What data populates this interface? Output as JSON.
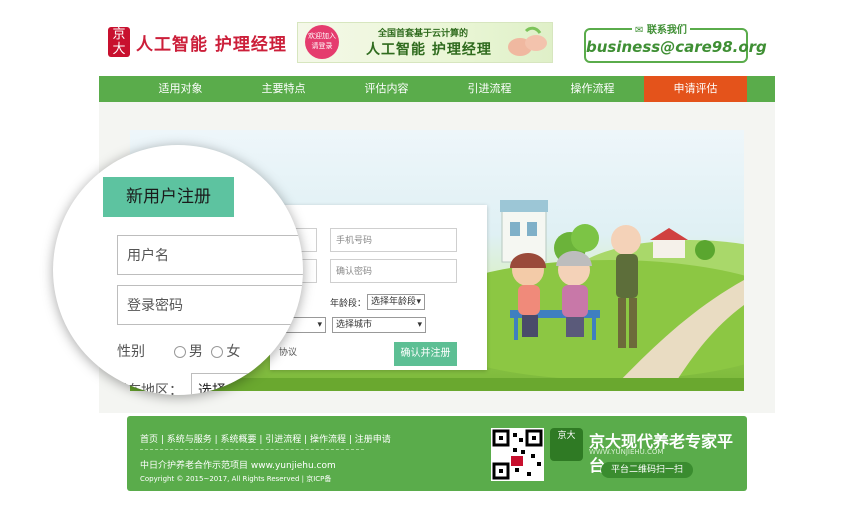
{
  "header": {
    "logo_glyph": "京大",
    "logo_text": "人工智能 护理经理",
    "banner": {
      "badge": "欢迎加入 请登录",
      "line1": "全国首套基于云计算的",
      "line2": "人工智能  护理经理"
    },
    "contact_label": "联系我们",
    "contact_email": "business@care98.org"
  },
  "nav": [
    {
      "label": "适用对象",
      "active": false
    },
    {
      "label": "主要特点",
      "active": false
    },
    {
      "label": "评估内容",
      "active": false
    },
    {
      "label": "引进流程",
      "active": false
    },
    {
      "label": "操作流程",
      "active": false
    },
    {
      "label": "申请评估",
      "active": true
    }
  ],
  "form": {
    "phone_placeholder": "手机号码",
    "confirm_password_placeholder": "确认密码",
    "age_label": "年龄段：",
    "age_select": "选择年龄段",
    "province_select": "",
    "city_select": "选择城市",
    "agreement_text": "协议",
    "submit_label": "确认并注册"
  },
  "magnifier": {
    "title": "新用户注册",
    "username_placeholder": "用户名",
    "password_placeholder": "登录密码",
    "gender_label": "性别",
    "gender_male": "男",
    "gender_female": "女",
    "region_label": "所在地区：",
    "region_select": "选择省"
  },
  "footer": {
    "links": "首页 | 系统与服务 | 系统概要 | 引进流程 | 操作流程 | 注册申请",
    "site": "中日介护养老合作示范项目 www.yunjiehu.com",
    "copyright": "Copyright © 2015~2017, All Rights Reserved | 京ICP备",
    "brand_glyph": "京大",
    "brand_name": "京大现代养老专家平台",
    "brand_url": "WWW.YUNJIEHU.COM",
    "scan_text": "平台二维码扫一扫"
  },
  "colors": {
    "primary_green": "#5aac4b",
    "accent_orange": "#e4531b",
    "teal": "#5dc3a0"
  }
}
